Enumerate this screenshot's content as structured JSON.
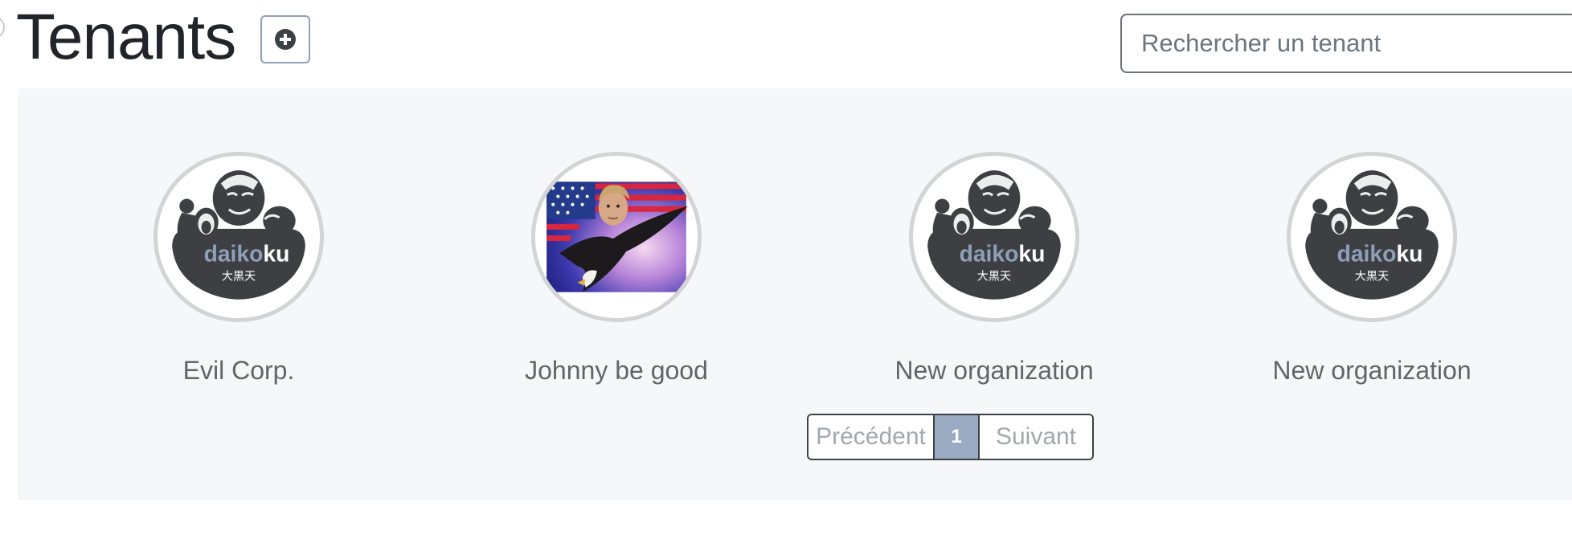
{
  "header": {
    "title": "Tenants",
    "add_icon": "plus-circle-icon"
  },
  "search": {
    "placeholder": "Rechercher un tenant",
    "value": ""
  },
  "tenants": [
    {
      "name": "Evil Corp.",
      "avatar": "daikoku-logo",
      "logo_text": "daikoku",
      "logo_kanji": "大黒天"
    },
    {
      "name": "Johnny be good",
      "avatar": "eagle-flag-photo"
    },
    {
      "name": "New organization",
      "avatar": "daikoku-logo",
      "logo_text": "daikoku",
      "logo_kanji": "大黒天"
    },
    {
      "name": "New organization",
      "avatar": "daikoku-logo",
      "logo_text": "daikoku",
      "logo_kanji": "大黒天"
    }
  ],
  "pagination": {
    "previous_label": "Précédent",
    "current_page": "1",
    "next_label": "Suivant"
  },
  "colors": {
    "panel_background": "#f6f7f9",
    "accent": "#9aabc3",
    "title": "#212529",
    "tenant_name": "#5f6569"
  }
}
